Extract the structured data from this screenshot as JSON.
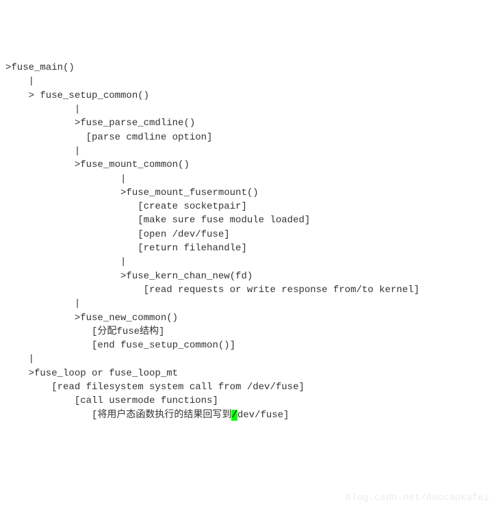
{
  "lines": [
    ">fuse_main()",
    "    |",
    "    > fuse_setup_common()",
    "            |",
    "            >fuse_parse_cmdline()",
    "              [parse cmdline option]",
    "            |",
    "            >fuse_mount_common()",
    "                    |",
    "                    >fuse_mount_fusermount()",
    "                       [create socketpair]",
    "                       [make sure fuse module loaded]",
    "                       [open /dev/fuse]",
    "                       [return filehandle]",
    "                    |",
    "                    >fuse_kern_chan_new(fd)",
    "                        [read requests or write response from/to kernel]",
    "            |",
    "            >fuse_new_common()",
    "               [分配fuse结构]",
    "               [end fuse_setup_common()]",
    "    |",
    "    >fuse_loop or fuse_loop_mt",
    "        [read filesystem system call from /dev/fuse]",
    "            [call usermode functions]"
  ],
  "last_line": {
    "prefix": "               [将用户态函数执行的结果回写到",
    "highlight_char": "/",
    "suffix": "dev/fuse]"
  },
  "watermark": "blog.csdn.net/daocaokafei"
}
